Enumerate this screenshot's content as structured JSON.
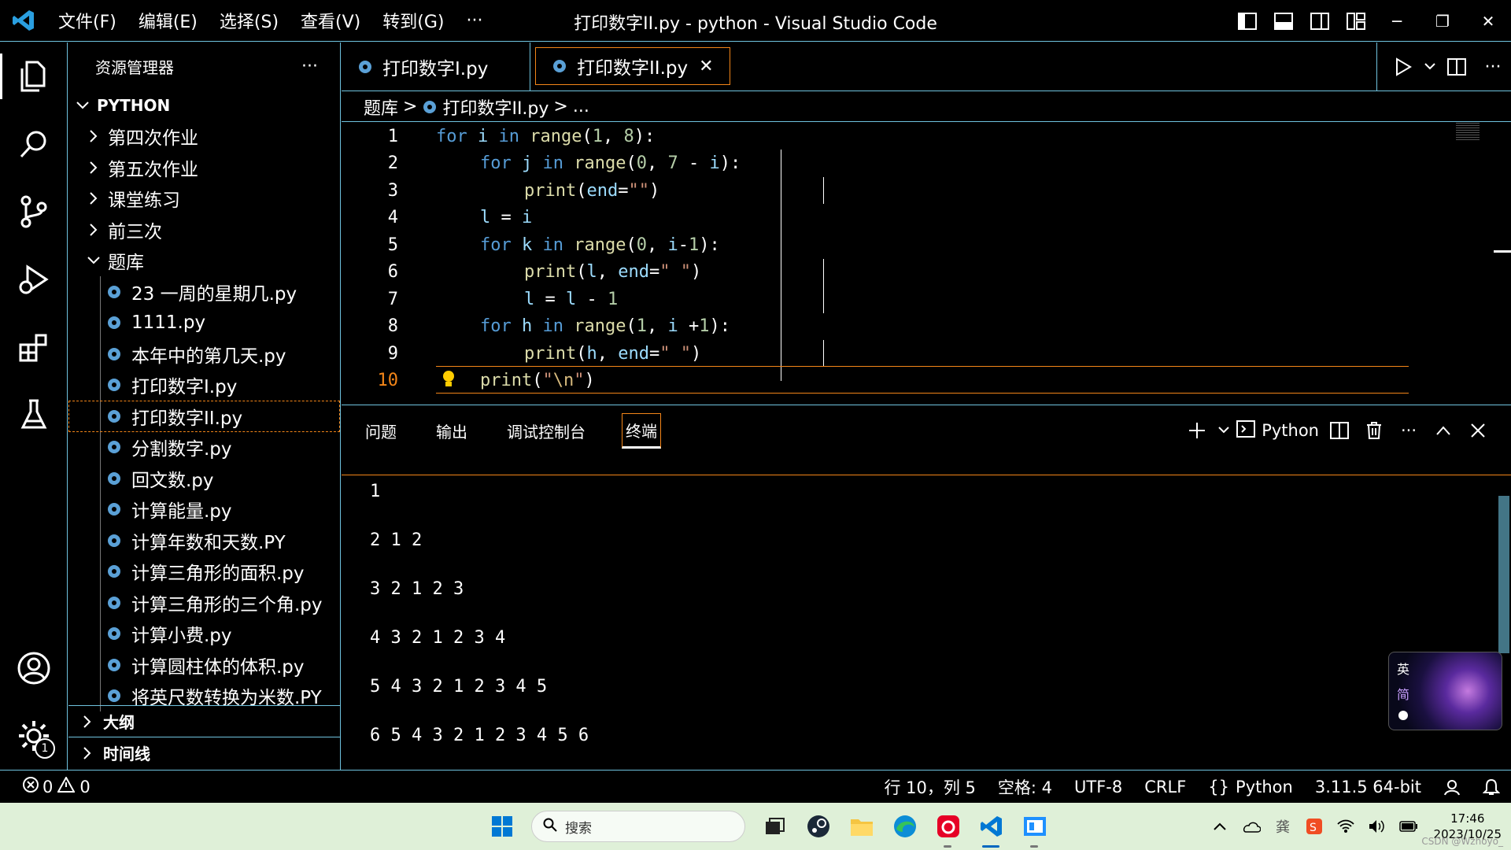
{
  "titlebar": {
    "menu": [
      "文件(F)",
      "编辑(E)",
      "选择(S)",
      "查看(V)",
      "转到(G)",
      "···"
    ],
    "title": "打印数字II.py - python - Visual Studio Code",
    "window_controls": [
      "─",
      "❐",
      "✕"
    ]
  },
  "sidebar": {
    "header": "资源管理器",
    "more": "···",
    "root": "PYTHON",
    "folders": [
      "第四次作业",
      "第五次作业",
      "课堂练习",
      "前三次"
    ],
    "open_folder": "题库",
    "files": [
      "23 一周的星期几.py",
      "1111.py",
      "本年中的第几天.py",
      "打印数字I.py",
      "打印数字II.py",
      "分割数字.py",
      "回文数.py",
      "计算能量.py",
      "计算年数和天数.PY",
      "计算三角形的面积.py",
      "计算三角形的三个角.py",
      "计算小费.py",
      "计算圆柱体的体积.py",
      "将英尺数转换为米数.PY"
    ],
    "selected_file": "打印数字II.py",
    "outline": "大纲",
    "timeline": "时间线"
  },
  "activity": {
    "settings_badge": "1"
  },
  "tabs": [
    {
      "label": "打印数字I.py",
      "active": false
    },
    {
      "label": "打印数字II.py",
      "active": true,
      "close": "✕"
    }
  ],
  "breadcrumb": {
    "folder": "题库",
    "sep": ">",
    "file": "打印数字II.py",
    "tail": "..."
  },
  "code": {
    "line_numbers": [
      "1",
      "2",
      "3",
      "4",
      "5",
      "6",
      "7",
      "8",
      "9",
      "10"
    ],
    "current_line": "10"
  },
  "panel": {
    "tabs": [
      "问题",
      "输出",
      "调试控制台",
      "终端"
    ],
    "active_tab": "终端",
    "terminal_name": "Python",
    "terminal_lines": [
      "1",
      "2 1 2",
      "3 2 1 2 3",
      "4 3 2 1 2 3 4",
      "5 4 3 2 1 2 3 4 5",
      "6 5 4 3 2 1 2 3 4 5 6"
    ]
  },
  "ime": {
    "lang": "英",
    "mode": "简"
  },
  "statusbar": {
    "errors": "0",
    "warnings": "0",
    "position": "行 10，列 5",
    "spaces": "空格: 4",
    "encoding": "UTF-8",
    "eol": "CRLF",
    "language": "Python",
    "interpreter": "3.11.5 64-bit"
  },
  "taskbar": {
    "search_placeholder": "搜索",
    "time": "17:46",
    "date": "2023/10/25",
    "watermark": "CSDN @Wzhoyo_"
  },
  "colors": {
    "accent_border": "#6fc3df",
    "focus_border": "#f38518"
  }
}
